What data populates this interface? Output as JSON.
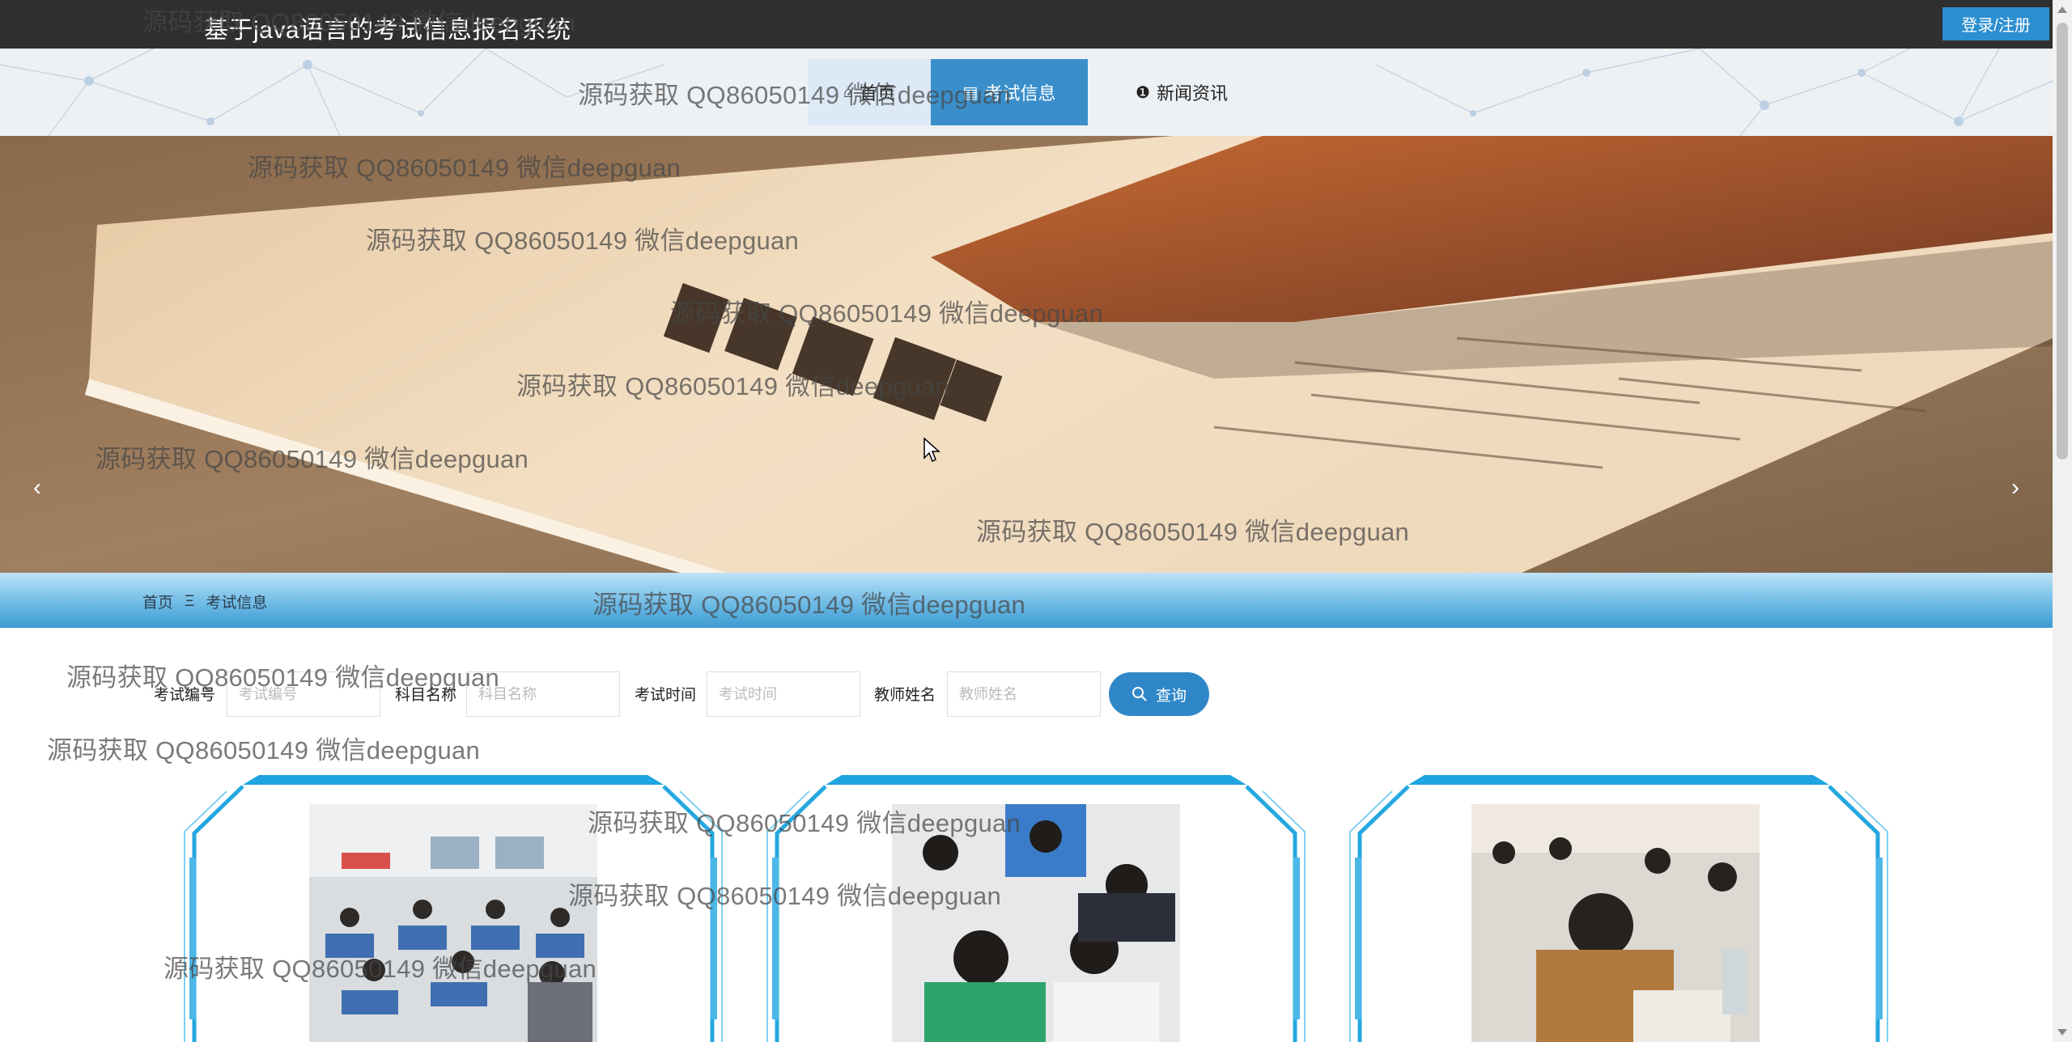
{
  "header": {
    "title": "基于java语言的考试信息报名系统",
    "login_label": "登录/注册"
  },
  "nav": {
    "items": [
      {
        "label": "首页",
        "icon": "home-icon"
      },
      {
        "label": "考试信息",
        "icon": "clipboard-icon"
      },
      {
        "label": "新闻资讯",
        "icon": "info-circle-icon"
      }
    ],
    "active": "考试信息"
  },
  "banner": {
    "prev_glyph": "‹",
    "next_glyph": "›",
    "slide_count": 3,
    "active_slide": 1
  },
  "breadcrumb": {
    "home": "首页",
    "separator": "Ξ",
    "current": "考试信息"
  },
  "search": {
    "fields": [
      {
        "label": "考试编号",
        "placeholder": "考试编号",
        "value": ""
      },
      {
        "label": "科目名称",
        "placeholder": "科目名称",
        "value": ""
      },
      {
        "label": "考试时间",
        "placeholder": "考试时间",
        "value": ""
      },
      {
        "label": "教师姓名",
        "placeholder": "教师姓名",
        "value": ""
      }
    ],
    "button_label": "查询",
    "button_icon": "search-icon"
  },
  "cards": [
    {
      "image": "classroom-exam-photo"
    },
    {
      "image": "students-writing-photo"
    },
    {
      "image": "student-reading-photo"
    }
  ],
  "watermark": {
    "text": "源码获取 QQ86050149 微信deepguan"
  },
  "colors": {
    "topbar": "#2f2f2f",
    "accent": "#2f87c8",
    "active_nav": "#3a8fcb",
    "frame": "#25a8e0"
  }
}
